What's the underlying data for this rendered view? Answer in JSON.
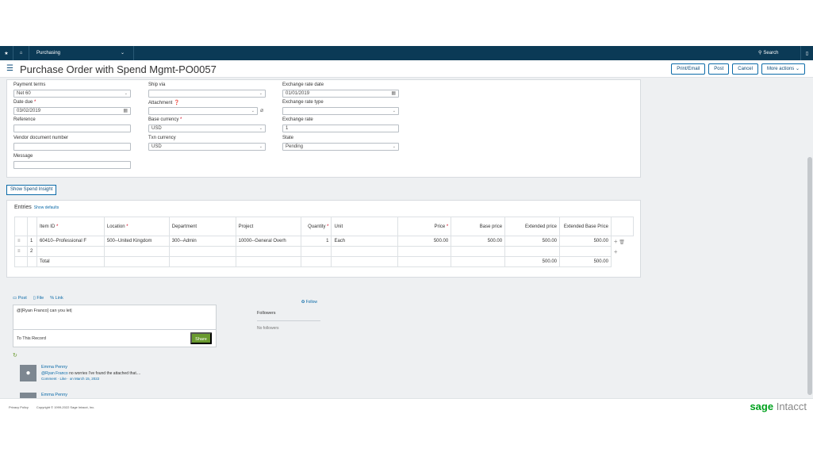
{
  "nav": {
    "menu": "Purchasing",
    "search": "Search"
  },
  "header": {
    "title": "Purchase Order with Spend Mgmt-PO0057",
    "buttons": [
      "Print/Email",
      "Post",
      "Cancel",
      "More actions"
    ]
  },
  "form": {
    "payment_terms": {
      "label": "Payment terms",
      "value": "Net 60"
    },
    "date_due": {
      "label": "Date due",
      "value": "03/02/2019"
    },
    "reference": {
      "label": "Reference",
      "value": ""
    },
    "vendor_doc": {
      "label": "Vendor document number",
      "value": ""
    },
    "message": {
      "label": "Message",
      "value": ""
    },
    "ship_via": {
      "label": "Ship via",
      "value": ""
    },
    "attachment": {
      "label": "Attachment",
      "value": ""
    },
    "base_currency": {
      "label": "Base currency",
      "value": "USD"
    },
    "txn_currency": {
      "label": "Txn currency",
      "value": "USD"
    },
    "exchange_rate_date": {
      "label": "Exchange rate date",
      "value": "01/01/2019"
    },
    "exchange_rate_type": {
      "label": "Exchange rate type",
      "value": ""
    },
    "exchange_rate": {
      "label": "Exchange rate",
      "value": "1"
    },
    "state": {
      "label": "State",
      "value": "Pending"
    }
  },
  "spend_insight_label": "Show Spend Insight",
  "entries": {
    "title": "Entries",
    "show_defaults": "Show defaults",
    "columns": {
      "item_id": "Item ID",
      "location": "Location",
      "department": "Department",
      "project": "Project",
      "quantity": "Quantity",
      "unit": "Unit",
      "price": "Price",
      "base_price": "Base price",
      "extended_price": "Extended price",
      "extended_base_price": "Extended Base Price"
    },
    "rows": [
      {
        "num": "1",
        "item_id": "60410--Professional F",
        "location": "500--United Kingdom",
        "department": "300--Admin",
        "project": "10000--General Overh",
        "quantity": "1",
        "unit": "Each",
        "price": "500.00",
        "base_price": "500.00",
        "extended_price": "500.00",
        "extended_base_price": "500.00"
      },
      {
        "num": "2",
        "item_id": "",
        "location": "",
        "department": "",
        "project": "",
        "quantity": "",
        "unit": "",
        "price": "",
        "base_price": "",
        "extended_price": "",
        "extended_base_price": ""
      }
    ],
    "total_label": "Total",
    "total_extended": "500.00",
    "total_extended_base": "500.00"
  },
  "collab": {
    "tabs": [
      "Post",
      "File",
      "Link"
    ],
    "message": "@[Ryan Franco]  can you let|",
    "to_label": "To This Record",
    "share_label": "Share",
    "follow_label": "Follow",
    "followers_title": "Followers",
    "no_followers": "No followers",
    "feed": [
      {
        "name": "Emma Penny",
        "mention": "@Ryan Franco",
        "text": " no worries I've found the attached that....",
        "meta": "Comment · Like · on March 15, 2022"
      },
      {
        "name": "Emma Penny"
      }
    ]
  },
  "footer": {
    "privacy": "Privacy Policy",
    "copyright": "Copyright © 1999-2022 Sage Intacct, Inc.",
    "logo_sage": "sage",
    "logo_intacct": "Intacct"
  },
  "colors": {
    "nav_bg": "#0b3a56",
    "accent": "#0b6aa8",
    "share_green": "#6a9a2f",
    "sage_green": "#00a21e"
  }
}
